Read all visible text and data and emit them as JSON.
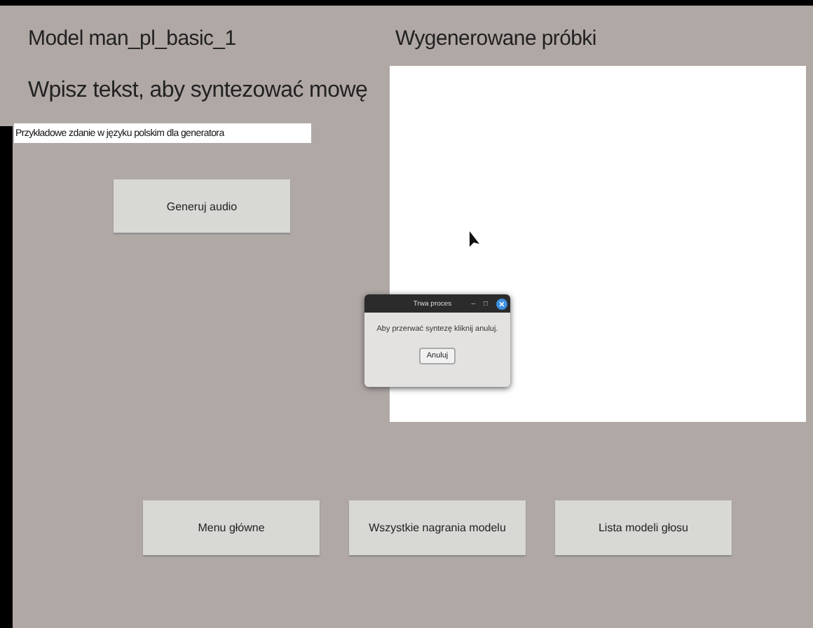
{
  "model_title": "Model man_pl_basic_1",
  "prompt_heading": "Wpisz tekst, aby syntezować mowę",
  "text_input": {
    "value": "Przykładowe zdanie w języku polskim dla generatora"
  },
  "generate_button": "Generuj audio",
  "samples": {
    "title": "Wygenerowane próbki"
  },
  "dialog": {
    "title": "Trwa proces",
    "minimize": "–",
    "maximize": "□",
    "message": "Aby przerwać syntezę kliknij anuluj.",
    "cancel_button": "Anuluj"
  },
  "nav_buttons": [
    "Menu główne",
    "Wszystkie nagrania modelu",
    "Lista modeli głosu"
  ]
}
